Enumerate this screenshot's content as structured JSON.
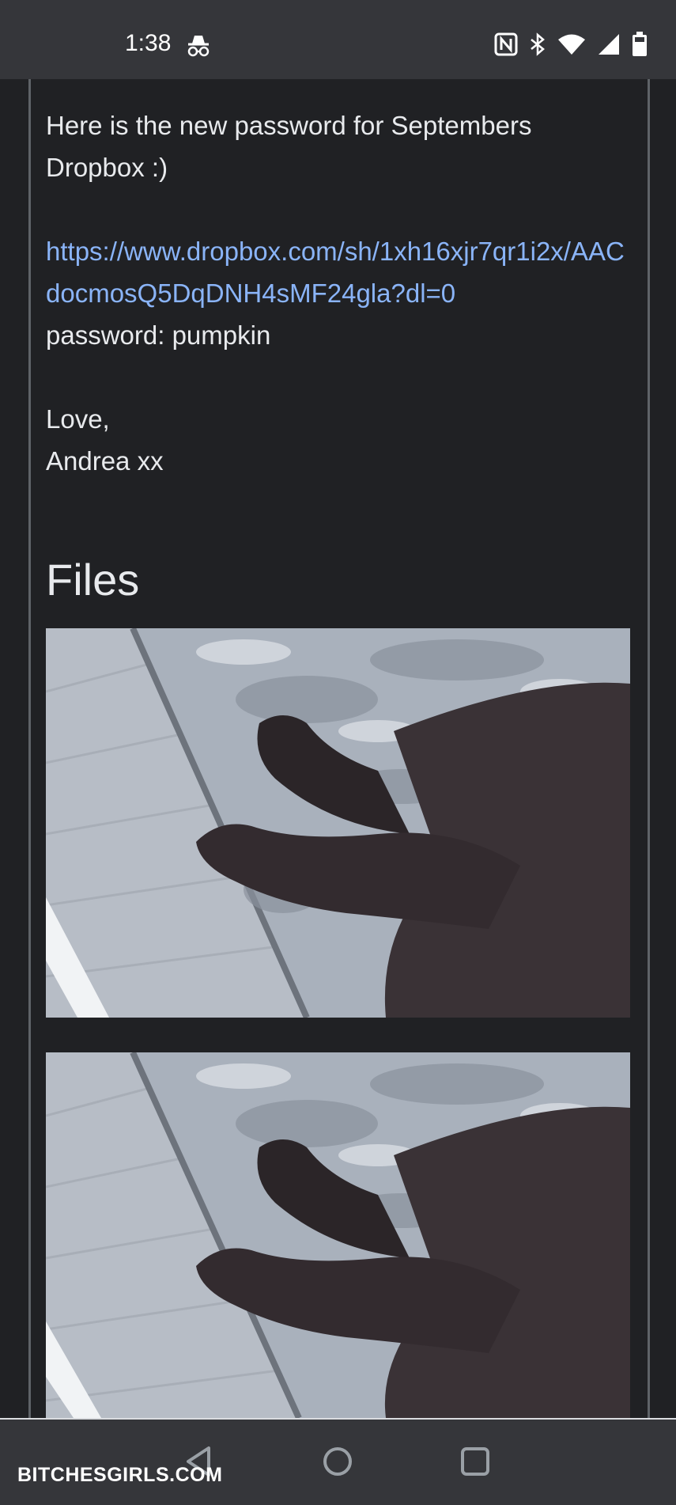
{
  "status_bar": {
    "time": "1:38",
    "icons": [
      "incognito-icon",
      "nfc-icon",
      "bluetooth-icon",
      "wifi-icon",
      "signal-icon",
      "battery-icon"
    ]
  },
  "message": {
    "line1": "Here is the new password for Septembers Dropbox :)",
    "link": "https://www.dropbox.com/sh/1xh16xjr7qr1i2x/AACdocmosQ5DqDNH4sMF24gla?dl=0",
    "password_line": "password: pumpkin",
    "closing": "Love,",
    "signature": "Andrea xx"
  },
  "files": {
    "heading": "Files"
  },
  "nav_bar": {
    "buttons": [
      "back-icon",
      "home-icon",
      "recents-icon"
    ]
  },
  "watermark": "BITCHESGIRLS.COM",
  "colors": {
    "background": "#202124",
    "status_bar": "#35363a",
    "link": "#8ab4f8",
    "text": "#e8eaed"
  }
}
